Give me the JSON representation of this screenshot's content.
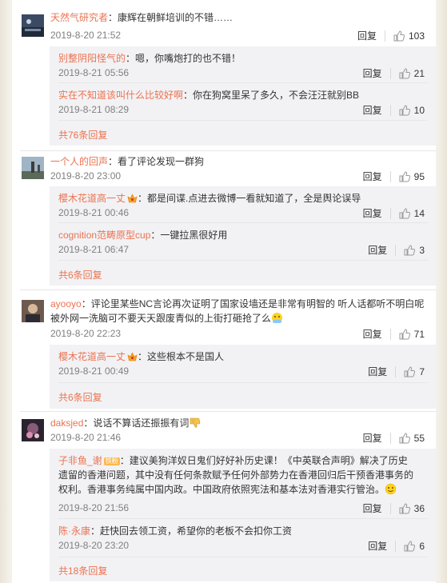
{
  "labels": {
    "reply": "回复"
  },
  "comments": [
    {
      "author": "天然气研究者",
      "text": "：康辉在朝鲜培训的不错……",
      "time": "2019-8-20 21:52",
      "likes": "103",
      "replies": [
        {
          "author": "别整阴阳怪气的",
          "text": "：嗯，你嘴炮打的也不错！",
          "time": "2019-8-21 05:56",
          "likes": "21"
        },
        {
          "author": "实在不知道该叫什么比较好啊",
          "text": "：你在狗窝里呆了多久，不会汪汪就别BB",
          "time": "2019-8-21 08:29",
          "likes": "10"
        }
      ],
      "more": "共76条回复"
    },
    {
      "author": "一个人的回声",
      "text": "：看了评论发现一群狗",
      "time": "2019-8-20 23:00",
      "likes": "95",
      "replies": [
        {
          "author": "樱木花道高一丈",
          "text": "：都是间谍.点进去微博一看就知道了，全是舆论误导",
          "time": "2019-8-21 00:46",
          "likes": "14"
        },
        {
          "author": "cognition范畴原型cup",
          "text": "：一键拉黑很好用",
          "time": "2019-8-21 06:47",
          "likes": "3"
        }
      ],
      "more": "共6条回复"
    },
    {
      "author": "ayooyo",
      "text": "：评论里某些NC言论再次证明了国家设墙还是非常有明智的 听人话都听不明白呢",
      "text2": "被外网一洗脑可不要天天跟废青似的上街打砸抢了么",
      "time": "2019-8-20 22:23",
      "likes": "71",
      "replies": [
        {
          "author": "樱木花道高一丈",
          "text": "：这些根本不是国人",
          "time": "2019-8-21 00:49",
          "likes": "7"
        }
      ],
      "more": "共6条回复"
    },
    {
      "author": "daksjed",
      "text": "：说话不算话还振振有词",
      "time": "2019-8-20 21:46",
      "likes": "55",
      "replies": [
        {
          "author": "子非鱼_谢",
          "badge": "铁粉",
          "text": "：建议美狗洋奴日鬼们好好补历史课！《中英联合声明》解决了历史",
          "text2": "遗留的香港问题，其中没有任何条款赋予任何外部势力在香港回归后干预香港事务的",
          "text3": "权利。香港事务纯属中国内政。中国政府依照宪法和基本法对香港实行管治。",
          "time": "2019-8-20 21:56",
          "likes": "36"
        },
        {
          "author": "陈·永康",
          "text": "：赶快回去领工资，希望你的老板不会扣你工资",
          "time": "2019-8-20 23:20",
          "likes": "6"
        }
      ],
      "more": "共18条回复"
    }
  ]
}
